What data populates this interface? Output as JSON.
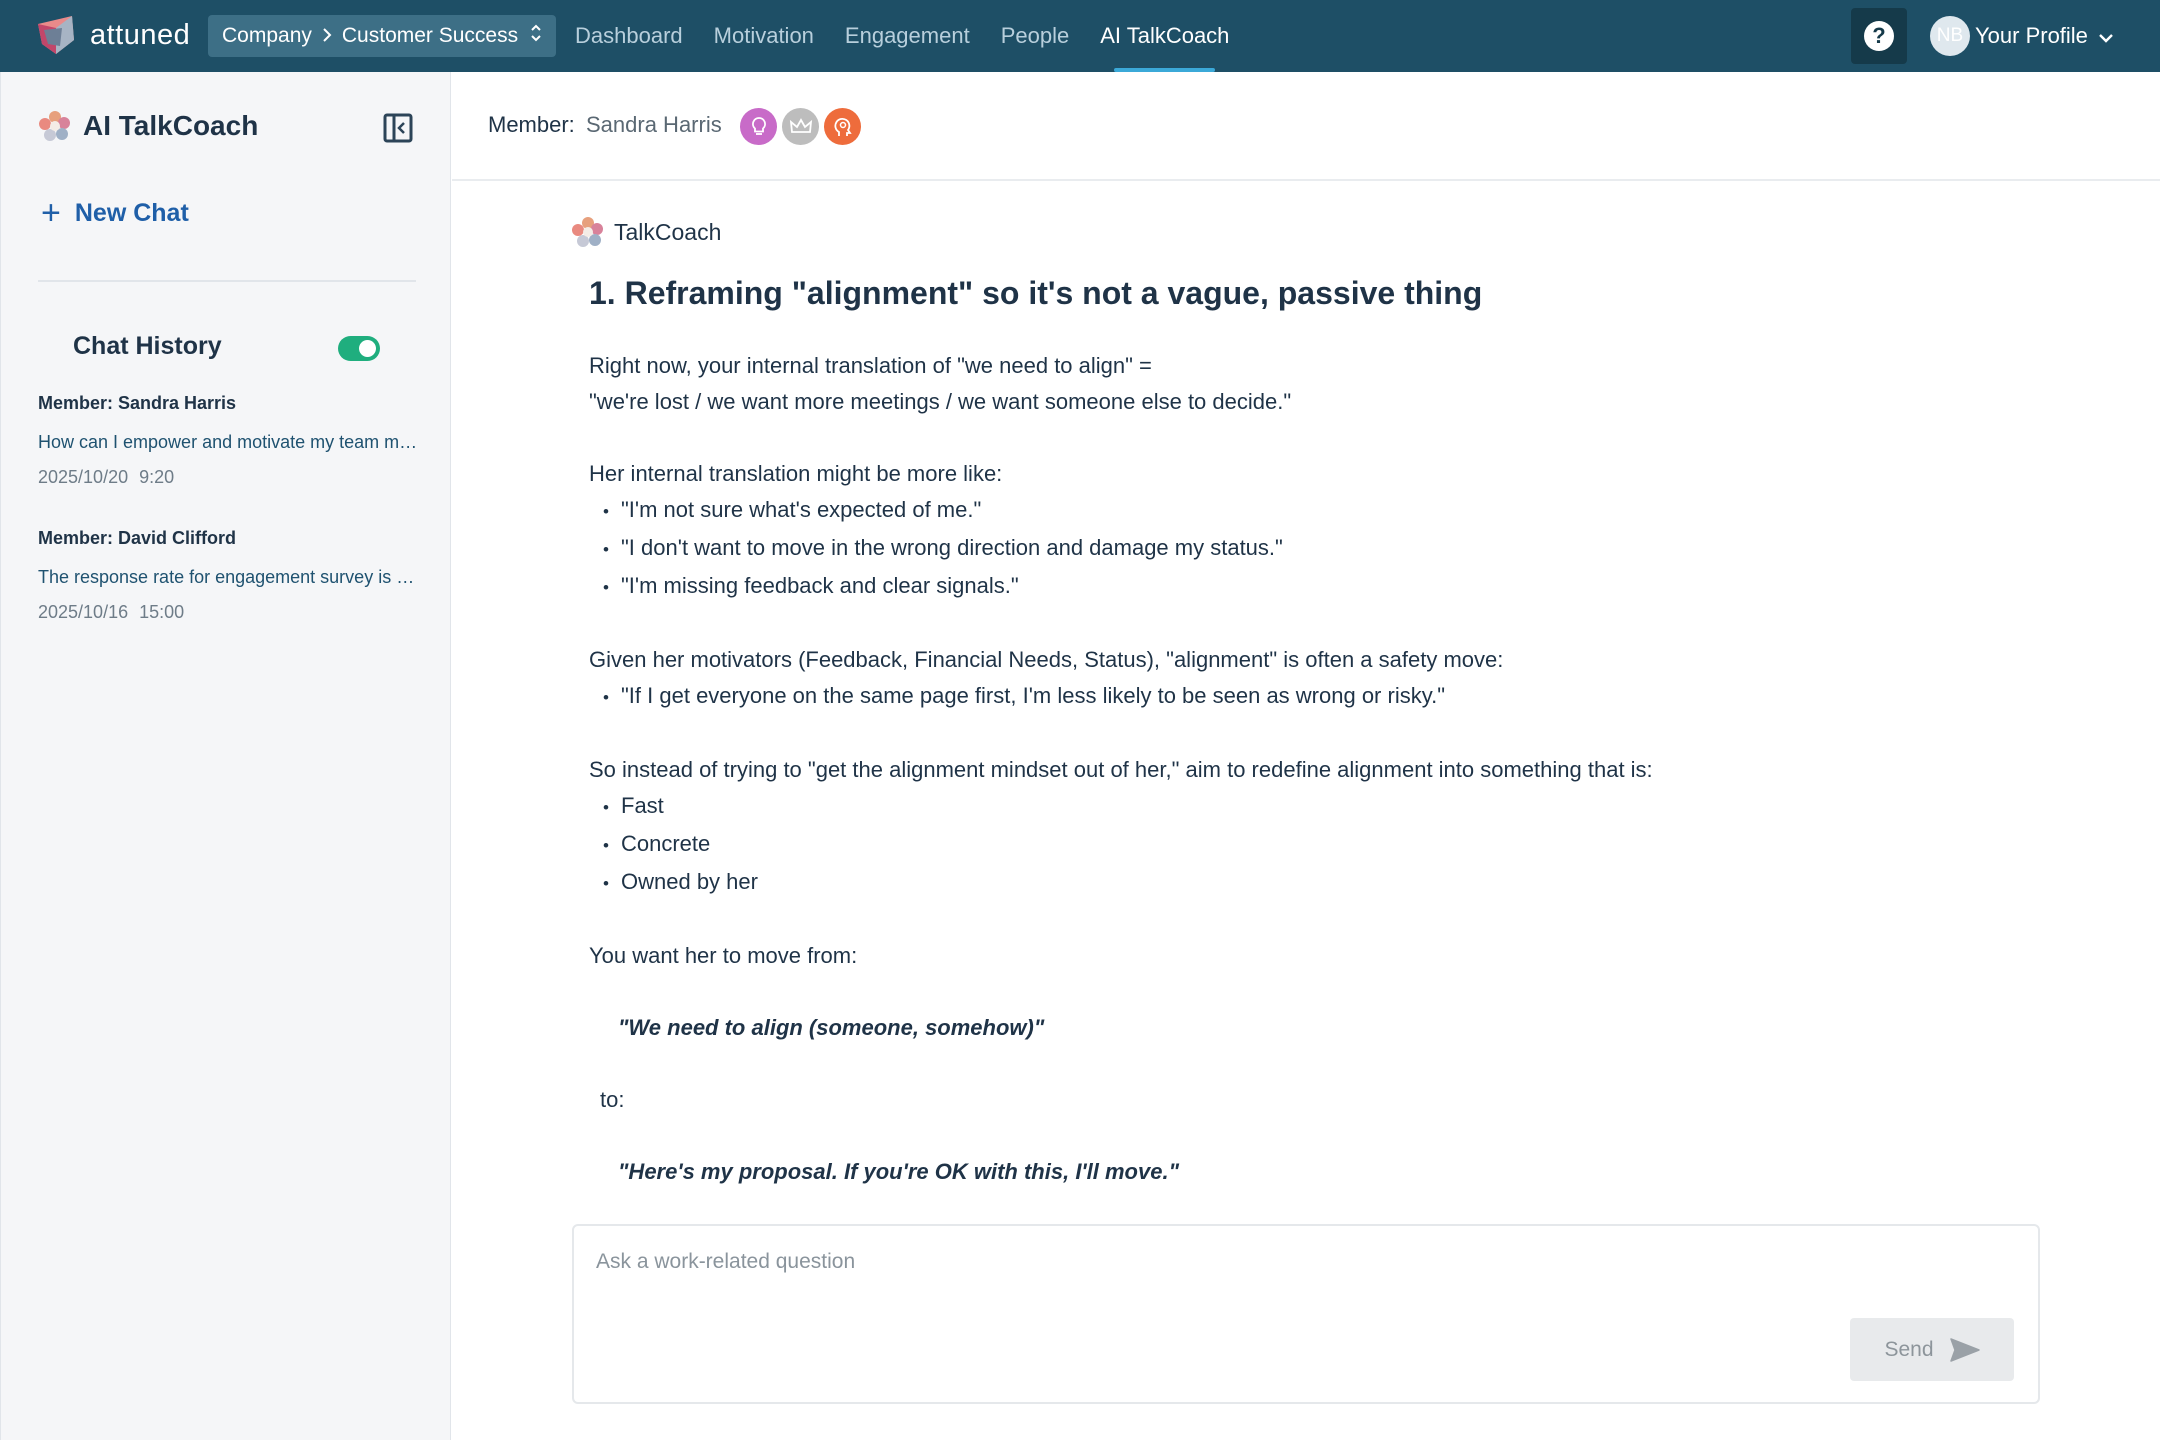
{
  "topbar": {
    "logo_text": "attuned",
    "org_switch": {
      "company": "Company",
      "team": "Customer Success"
    },
    "nav": [
      "Dashboard",
      "Motivation",
      "Engagement",
      "People",
      "AI TalkCoach"
    ],
    "active_nav": "AI TalkCoach",
    "help_label": "?",
    "profile": {
      "initials": "NB",
      "label": "Your Profile"
    }
  },
  "sidebar": {
    "title": "AI TalkCoach",
    "new_chat": "New Chat",
    "history_title": "Chat History",
    "history_toggle_on": true,
    "history": [
      {
        "member": "Member: Sandra Harris",
        "preview": "How can I empower and motivate my team members to take more ownership?",
        "date": "2025/10/20 9:20"
      },
      {
        "member": "Member: David Clifford",
        "preview": "The response rate for engagement survey is low, what can I do?",
        "date": "2025/10/16 15:00"
      }
    ]
  },
  "main": {
    "member_label": "Member:",
    "member_name": "Sandra Harris",
    "badges": [
      {
        "icon": "lightbulb-icon",
        "color": "#c86bc8"
      },
      {
        "icon": "crown-icon",
        "color": "#bdbdbd"
      },
      {
        "icon": "head-icon",
        "color": "#ee6c3c"
      }
    ],
    "author": "TalkCoach",
    "message": {
      "heading": "1. Reframing \"alignment\" so it's not a vague, passive thing",
      "p1_l1": "Right now, your internal translation of \"we need to align\" =",
      "p1_l2": "\"we're lost / we want more meetings / we want someone else to decide.\"",
      "p2_intro": "Her internal translation might be more like:",
      "p2_b1": "\"I'm not sure what's expected of me.\"",
      "p2_b2": "\"I don't want to move in the wrong direction and damage my status.\"",
      "p2_b3": "\"I'm missing feedback and clear signals.\"",
      "p3_intro": "Given her motivators (Feedback, Financial Needs, Status), \"alignment\" is often a safety move:",
      "p3_b1": "\"If I get everyone on the same page first, I'm less likely to be seen as wrong or risky.\"",
      "p4_intro": "So instead of trying to \"get the alignment mindset out of her,\" aim to redefine alignment into something that is:",
      "p4_b1": "Fast",
      "p4_b2": "Concrete",
      "p4_b3": "Owned by her",
      "p5_intro": "You want her to move from:",
      "quote_from": "\"We need to align (someone, somehow)\"",
      "to": "to:",
      "quote_to": "\"Here's my proposal. If you're OK with this, I'll move.\""
    },
    "composer": {
      "placeholder": "Ask a work-related question",
      "value": "",
      "send": "Send"
    }
  },
  "colors": {
    "topbar": "#1e4f66",
    "accent": "#3ba9d8",
    "toggle": "#1fae7e",
    "link": "#1f5fa8"
  }
}
